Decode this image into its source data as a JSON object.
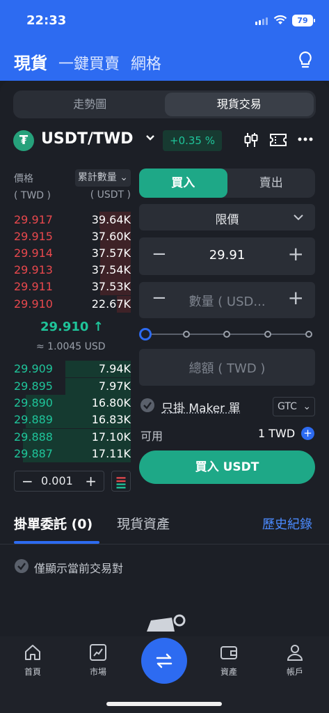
{
  "status": {
    "time": "22:33",
    "battery": "79"
  },
  "top_tabs": [
    {
      "label": "現貨",
      "active": true
    },
    {
      "label": "一鍵買賣"
    },
    {
      "label": "網格"
    }
  ],
  "view_switch": {
    "chart": "走勢圖",
    "trade": "現貨交易"
  },
  "pair": {
    "name": "USDT/TWD",
    "change": "+0.35 %",
    "icon": "tether-icon",
    "icon_glyph": "₮"
  },
  "orderbook": {
    "price_label": "價格",
    "price_unit": "( TWD )",
    "qty_label": "累計數量",
    "qty_unit": "( USDT )",
    "asks": [
      {
        "price": "29.917",
        "qty": "39.64K",
        "depth": 0.27
      },
      {
        "price": "29.915",
        "qty": "37.60K",
        "depth": 0.26
      },
      {
        "price": "29.914",
        "qty": "37.57K",
        "depth": 0.26
      },
      {
        "price": "29.913",
        "qty": "37.54K",
        "depth": 0.26
      },
      {
        "price": "29.911",
        "qty": "37.53K",
        "depth": 0.26
      },
      {
        "price": "29.910",
        "qty": "22.67K",
        "depth": 0.12
      }
    ],
    "mid_price": "29.910 ↑",
    "mid_fiat": "≈ 1.0045 USD",
    "bids": [
      {
        "price": "29.909",
        "qty": "7.94K",
        "depth": 0.56
      },
      {
        "price": "29.895",
        "qty": "7.97K",
        "depth": 0.56
      },
      {
        "price": "29.890",
        "qty": "16.80K",
        "depth": 0.9
      },
      {
        "price": "29.889",
        "qty": "16.83K",
        "depth": 0.9
      },
      {
        "price": "29.888",
        "qty": "17.10K",
        "depth": 0.92
      },
      {
        "price": "29.887",
        "qty": "17.11K",
        "depth": 0.92
      }
    ],
    "tick_minus": "−",
    "tick_value": "0.001",
    "tick_plus": "+"
  },
  "order_form": {
    "buy_tab": "買入",
    "sell_tab": "賣出",
    "order_type": "限價",
    "price_value": "29.91",
    "qty_placeholder": "數量 ( USD...",
    "total_placeholder": "總額 ( TWD )",
    "maker_only": "只掛 Maker 單",
    "tif": "GTC",
    "available_label": "可用",
    "available_value": "1 TWD",
    "submit": "買入 USDT",
    "slider_level": 0
  },
  "orders_section": {
    "tab_open": "掛單委託 (0)",
    "tab_assets": "現貨資產",
    "history": "歷史紀錄",
    "only_current": "僅顯示當前交易對"
  },
  "nav": [
    {
      "label": "首頁",
      "icon": "home-icon"
    },
    {
      "label": "市場",
      "icon": "chart-icon"
    },
    {
      "label": "",
      "icon": "swap-icon"
    },
    {
      "label": "資產",
      "icon": "wallet-icon"
    },
    {
      "label": "帳戶",
      "icon": "person-icon"
    }
  ],
  "colors": {
    "brand": "#2d6bf1",
    "buy": "#1ea887",
    "up": "#1fc49a",
    "down": "#e8484d"
  }
}
